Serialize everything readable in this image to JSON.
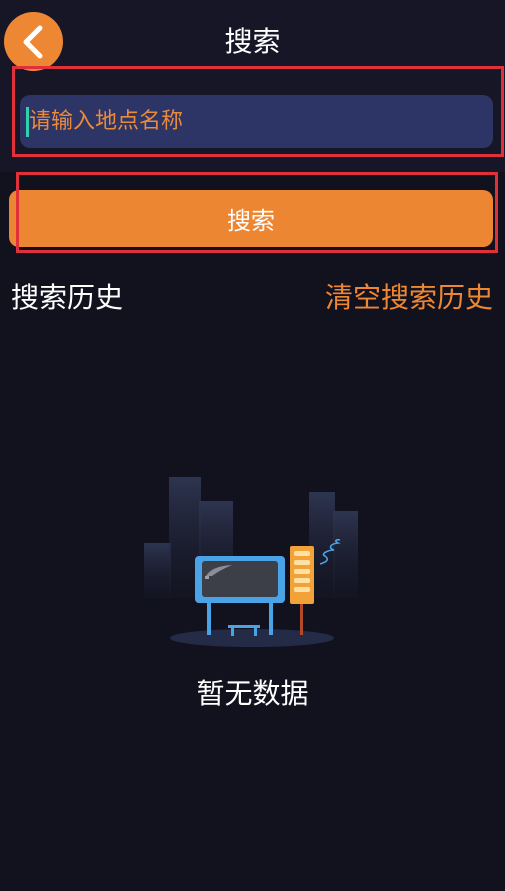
{
  "header": {
    "title": "搜索",
    "back_icon": "chevron-left-icon"
  },
  "search": {
    "placeholder": "请输入地点名称",
    "value": "",
    "button_label": "搜索"
  },
  "history": {
    "title": "搜索历史",
    "clear_label": "清空搜索历史",
    "empty_text": "暂无数据",
    "empty_icon": "empty-billboard-illustration"
  },
  "colors": {
    "background": "#12121f",
    "accent": "#ee8733",
    "input_background": "#2d3466",
    "highlight": "#e0303a"
  }
}
